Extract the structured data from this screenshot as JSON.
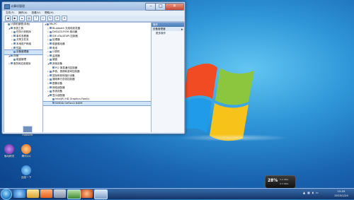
{
  "window": {
    "title": "计算机管理",
    "menu": [
      "文件(F)",
      "操作(A)",
      "查看(V)",
      "帮助(H)"
    ],
    "toolbar_icons": [
      "back-icon",
      "forward-icon",
      "up-icon",
      "properties-icon",
      "help-icon",
      "scan-icon",
      "update-icon",
      "disable-icon",
      "uninstall-icon"
    ]
  },
  "left_tree": [
    {
      "label": "计算机管理(本地)",
      "indent": 0,
      "exp": ""
    },
    {
      "label": "系统工具",
      "indent": 1,
      "exp": "◢"
    },
    {
      "label": "任务计划程序",
      "indent": 2,
      "exp": "▷"
    },
    {
      "label": "事件查看器",
      "indent": 2,
      "exp": "▷"
    },
    {
      "label": "共享文件夹",
      "indent": 2,
      "exp": "▷"
    },
    {
      "label": "本地用户和组",
      "indent": 2,
      "exp": "▷"
    },
    {
      "label": "性能",
      "indent": 2,
      "exp": "▷"
    },
    {
      "label": "设备管理器",
      "indent": 2,
      "exp": "",
      "selected": true
    },
    {
      "label": "存储",
      "indent": 1,
      "exp": "◢"
    },
    {
      "label": "磁盘管理",
      "indent": 2,
      "exp": ""
    },
    {
      "label": "服务和应用程序",
      "indent": 1,
      "exp": "▷"
    }
  ],
  "device_tree": [
    {
      "label": "Mk-PC",
      "indent": 0,
      "exp": "◢"
    },
    {
      "label": "Bluetooth 无线电收发器",
      "indent": 1,
      "exp": "▷"
    },
    {
      "label": "DVD/CD-ROM 驱动器",
      "indent": 1,
      "exp": "▷"
    },
    {
      "label": "IDE ATA/ATAPI 控制器",
      "indent": 1,
      "exp": "▷"
    },
    {
      "label": "处理器",
      "indent": 1,
      "exp": "▷"
    },
    {
      "label": "磁盘驱动器",
      "indent": 1,
      "exp": "▷"
    },
    {
      "label": "电池",
      "indent": 1,
      "exp": "▷"
    },
    {
      "label": "计算机",
      "indent": 1,
      "exp": "▷"
    },
    {
      "label": "监视器",
      "indent": 1,
      "exp": "▷"
    },
    {
      "label": "键盘",
      "indent": 1,
      "exp": "▷"
    },
    {
      "label": "其他设备",
      "indent": 1,
      "exp": "◢"
    },
    {
      "label": "PCI 简易通讯控制器",
      "indent": 2,
      "exp": ""
    },
    {
      "label": "声音、视频和游戏控制器",
      "indent": 1,
      "exp": "▷"
    },
    {
      "label": "鼠标和其他指针设备",
      "indent": 1,
      "exp": "▷"
    },
    {
      "label": "通用串行总线控制器",
      "indent": 1,
      "exp": "▷"
    },
    {
      "label": "图像设备",
      "indent": 1,
      "exp": "▷"
    },
    {
      "label": "网络适配器",
      "indent": 1,
      "exp": "▷"
    },
    {
      "label": "系统设备",
      "indent": 1,
      "exp": "▷"
    },
    {
      "label": "显示适配器",
      "indent": 1,
      "exp": "◢"
    },
    {
      "label": "Intel(R) HD Graphics Family",
      "indent": 2,
      "exp": ""
    },
    {
      "label": "NVIDIA GeForce 840M",
      "indent": 2,
      "exp": "",
      "selected": true
    }
  ],
  "actions": {
    "header": "操作",
    "sub": "设备管理器",
    "more": "更多操作"
  },
  "desktop_icons": [
    {
      "label": "Explorer",
      "color": "#4a74b0"
    },
    {
      "label": "驱动精灵",
      "color": "#7a3cb8"
    },
    {
      "label": "腾讯QQ",
      "color": "#e8781e"
    },
    {
      "label": "百度一下",
      "color": "#2a86d8"
    }
  ],
  "gadget": {
    "value": "28%",
    "line1": "0.9 KB/s",
    "line2": "0.3 KB/s"
  },
  "taskbar": {
    "apps": [
      "ie",
      "explorer",
      "media",
      "screen",
      "player",
      "computer-management"
    ]
  },
  "clock": {
    "time": "15:25",
    "date": "2015/1/24"
  }
}
